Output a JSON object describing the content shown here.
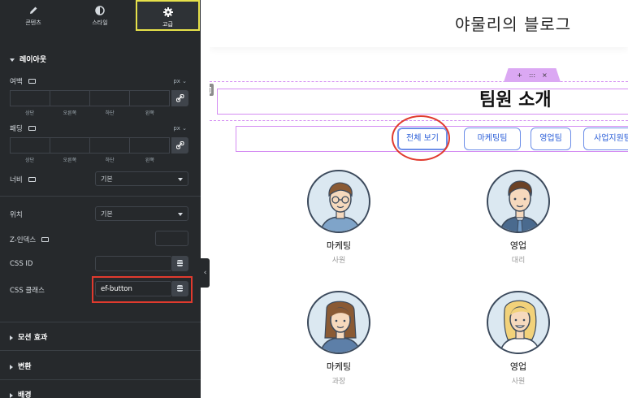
{
  "panel": {
    "tabs": [
      {
        "label": "콘텐츠",
        "icon": "pencil-icon"
      },
      {
        "label": "스타일",
        "icon": "half-circle-icon"
      },
      {
        "label": "고급",
        "icon": "gear-icon",
        "active": true
      }
    ],
    "layout_section": {
      "title": "레이아웃",
      "margin_label": "여백",
      "margin_unit": "px",
      "padding_label": "패딩",
      "padding_unit": "px",
      "sides": [
        "상단",
        "오른쪽",
        "하단",
        "왼쪽"
      ],
      "width_label": "너비",
      "width_value": "기본",
      "position_label": "위치",
      "position_value": "기본",
      "zindex_label": "Z-인덱스",
      "zindex_value": "",
      "css_id_label": "CSS ID",
      "css_id_value": "",
      "css_class_label": "CSS 클래스",
      "css_class_value": "ef-button"
    },
    "collapsed_sections": [
      "모션 효과",
      "변환",
      "배경"
    ],
    "accent_color": "#e6e14a",
    "highlight_color": "#e03a2e"
  },
  "site": {
    "title": "야물리의 블로그",
    "section_handle": [
      "+",
      ":::",
      "×"
    ],
    "heading": "팀원 소개",
    "filters": [
      "전체 보기",
      "마케팅팀",
      "영업팀",
      "사업지원팀"
    ],
    "members": [
      {
        "team": "마케팅",
        "rank": "사원",
        "avatar": "man-glasses-avatar"
      },
      {
        "team": "영업",
        "rank": "대리",
        "avatar": "man-tie-avatar"
      },
      {
        "team": "마케팅",
        "rank": "과장",
        "avatar": "woman-brown-hair-avatar"
      },
      {
        "team": "영업",
        "rank": "사원",
        "avatar": "woman-blonde-avatar"
      }
    ],
    "accent_color": "#2c5fd8",
    "editing_border_color": "#d48cf2"
  }
}
